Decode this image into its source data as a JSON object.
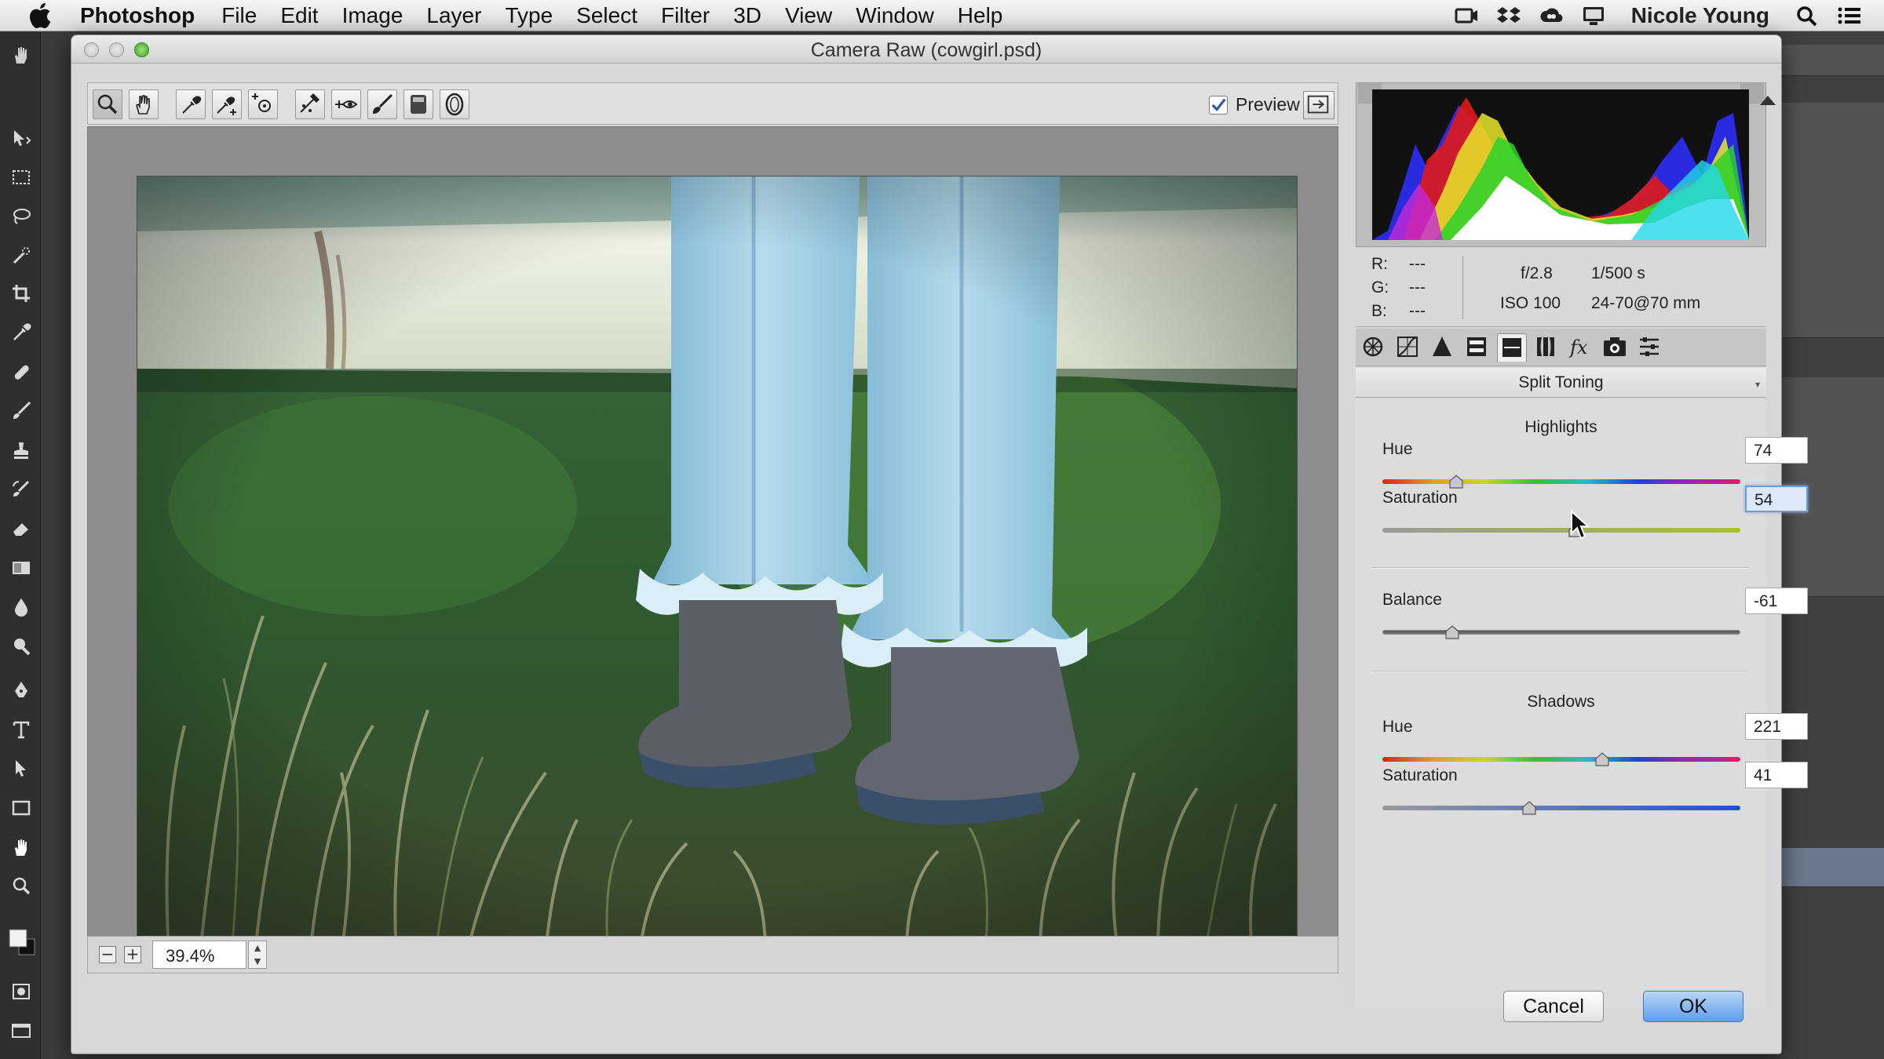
{
  "menubar": {
    "app_name": "Photoshop",
    "items": [
      "File",
      "Edit",
      "Image",
      "Layer",
      "Type",
      "Select",
      "Filter",
      "3D",
      "View",
      "Window",
      "Help"
    ],
    "user_name": "Nicole Young"
  },
  "dialog": {
    "title": "Camera Raw (cowgirl.psd)",
    "preview_label": "Preview",
    "preview_checked": true,
    "zoom_value": "39.4%",
    "cancel_label": "Cancel",
    "ok_label": "OK"
  },
  "readout": {
    "r_label": "R:",
    "r_value": "---",
    "g_label": "G:",
    "g_value": "---",
    "b_label": "B:",
    "b_value": "---",
    "aperture": "f/2.8",
    "shutter": "1/500 s",
    "iso": "ISO 100",
    "lens": "24-70@70 mm"
  },
  "panel": {
    "title": "Split Toning",
    "highlights_title": "Highlights",
    "highlights_hue_label": "Hue",
    "highlights_hue": 74,
    "highlights_saturation_label": "Saturation",
    "highlights_saturation": 54,
    "balance_label": "Balance",
    "balance": -61,
    "shadows_title": "Shadows",
    "shadows_hue_label": "Hue",
    "shadows_hue": 221,
    "shadows_saturation_label": "Saturation",
    "shadows_saturation": 41
  },
  "icons": {
    "toolbar": [
      "zoom-icon",
      "hand-icon",
      "white-balance-icon",
      "color-sampler-icon",
      "target-adjustment-icon",
      "crop-straighten-icon",
      "spot-removal-icon",
      "red-eye-icon",
      "adjustment-brush-icon",
      "graduated-filter-icon",
      "radial-filter-icon"
    ],
    "panel_tabs": [
      "basic-tab-icon",
      "tone-curve-tab-icon",
      "detail-tab-icon",
      "hsl-tab-icon",
      "split-toning-tab-icon",
      "lens-corrections-tab-icon",
      "effects-tab-icon",
      "camera-calibration-tab-icon",
      "presets-tab-icon"
    ]
  },
  "colors": {
    "ok_button": "#5f9ded",
    "focused_field": "#6e9ad6"
  }
}
